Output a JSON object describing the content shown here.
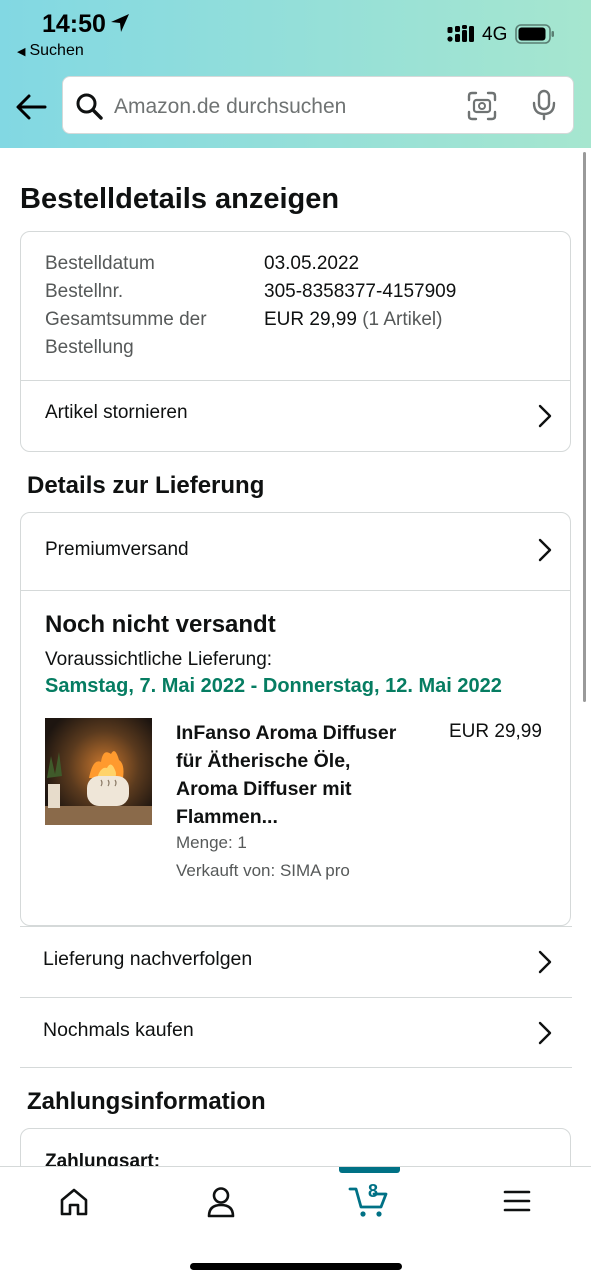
{
  "status_bar": {
    "time": "14:50",
    "back_app": "Suchen",
    "network": "4G"
  },
  "search": {
    "placeholder": "Amazon.de durchsuchen"
  },
  "page": {
    "title": "Bestelldetails anzeigen"
  },
  "order_summary": {
    "rows": [
      {
        "label": "Bestelldatum",
        "value": "03.05.2022"
      },
      {
        "label": "Bestellnr.",
        "value": "305-8358377-4157909"
      },
      {
        "label_line1": "Gesamtsumme der",
        "label_line2": "Bestellung",
        "value": "EUR 29,99",
        "value_sub": "(1 Artikel)"
      }
    ],
    "cancel_label": "Artikel stornieren"
  },
  "delivery": {
    "section_title": "Details zur Lieferung",
    "shipping_method": "Premiumversand",
    "status": "Noch nicht versandt",
    "expected_label": "Voraussichtliche Lieferung:",
    "expected_date": "Samstag, 7. Mai 2022 - Donnerstag, 12. Mai 2022",
    "product": {
      "name": "InFanso Aroma Diffuser für Ätherische Öle, Aroma Diffuser mit Flammen...",
      "price": "EUR 29,99",
      "quantity": "Menge: 1",
      "seller": "Verkauft von: SIMA pro"
    },
    "actions": [
      {
        "label": "Lieferung nachverfolgen"
      },
      {
        "label": "Nochmals kaufen"
      }
    ]
  },
  "payment": {
    "section_title": "Zahlungsinformation",
    "method_label": "Zahlungsart:"
  },
  "tabbar": {
    "cart_count": "8",
    "active_tab": "cart",
    "accent_color": "#007185"
  },
  "colors": {
    "delivery_green": "#067d62",
    "header_gradient_start": "#82d8e3",
    "header_gradient_end": "#a6e6cf"
  }
}
